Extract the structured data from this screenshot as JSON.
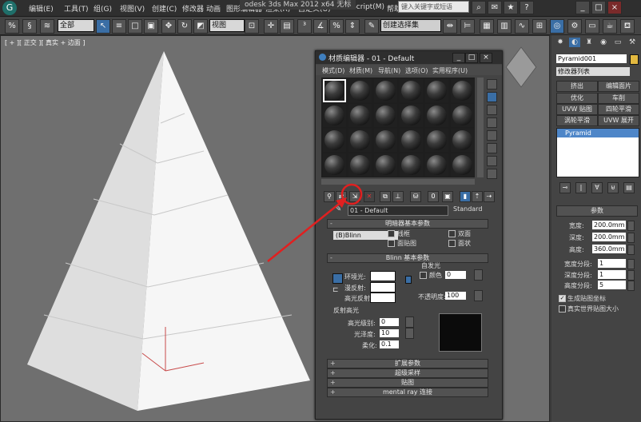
{
  "menubar": {
    "items": [
      "编辑(E)",
      "工具(T)",
      "组(G)",
      "视图(V)",
      "创建(C)",
      "修改器",
      "动画",
      "图形编辑器",
      "渲染(R)",
      "自定义(U)",
      "MAXScript(M)",
      "帮助(H)"
    ],
    "title": "odesk 3ds Max  2012 x64    无标",
    "search_placeholder": "键入关键字或短语"
  },
  "toolbar": {
    "selection_filter": "全部",
    "reference_coord": "视图",
    "named_selection": "创建选择集"
  },
  "viewport": {
    "label": "[ + ][ 正交 ][ 真实 + 边面 ]"
  },
  "command_panel": {
    "object_name": "Pyramid001",
    "object_color": "#e3b940",
    "modifier_list": "修改器列表",
    "modifier_buttons": [
      "挤出",
      "编辑面片",
      "优化",
      "车削",
      "UVW 贴图",
      "四轮平滑",
      "涡轮平滑",
      "UVW 展开"
    ],
    "stack_item": "Pyramid",
    "params": {
      "title": "参数",
      "width_label": "宽度:",
      "width_value": "200.0mm",
      "depth_label": "深度:",
      "depth_value": "200.0mm",
      "height_label": "高度:",
      "height_value": "360.0mm",
      "width_segs_label": "宽度分段:",
      "width_segs_value": "1",
      "depth_segs_label": "深度分段:",
      "depth_segs_value": "1",
      "height_segs_label": "高度分段:",
      "height_segs_value": "5",
      "gen_mapping": "生成贴图坐标",
      "real_world": "真实世界贴图大小"
    }
  },
  "material_editor": {
    "title": "材质编辑器 - 01 - Default",
    "menu": [
      "模式(D)",
      "材质(M)",
      "导航(N)",
      "选项(O)",
      "实用程序(U)"
    ],
    "material_name": "01 - Default",
    "material_type": "Standard",
    "shader_rollout": "明暗器基本参数",
    "shader_type": "(B)Blinn",
    "shader_options": [
      "线框",
      "双面",
      "面贴图",
      "面状"
    ],
    "blinn_rollout": "Blinn 基本参数",
    "self_illum": "自发光",
    "color_label": "颜色",
    "color_value": "0",
    "ambient": "环境光:",
    "diffuse": "漫反射:",
    "specular": "高光反射:",
    "opacity_label": "不透明度:",
    "opacity_value": "100",
    "spec_highlights": "反射高光",
    "spec_level_label": "高光级别:",
    "spec_level_value": "0",
    "gloss_label": "光泽度:",
    "gloss_value": "10",
    "soften_label": "柔化:",
    "soften_value": "0.1",
    "bottom_rollouts": [
      "扩展参数",
      "超级采样",
      "贴图",
      "mental ray 连接"
    ]
  }
}
